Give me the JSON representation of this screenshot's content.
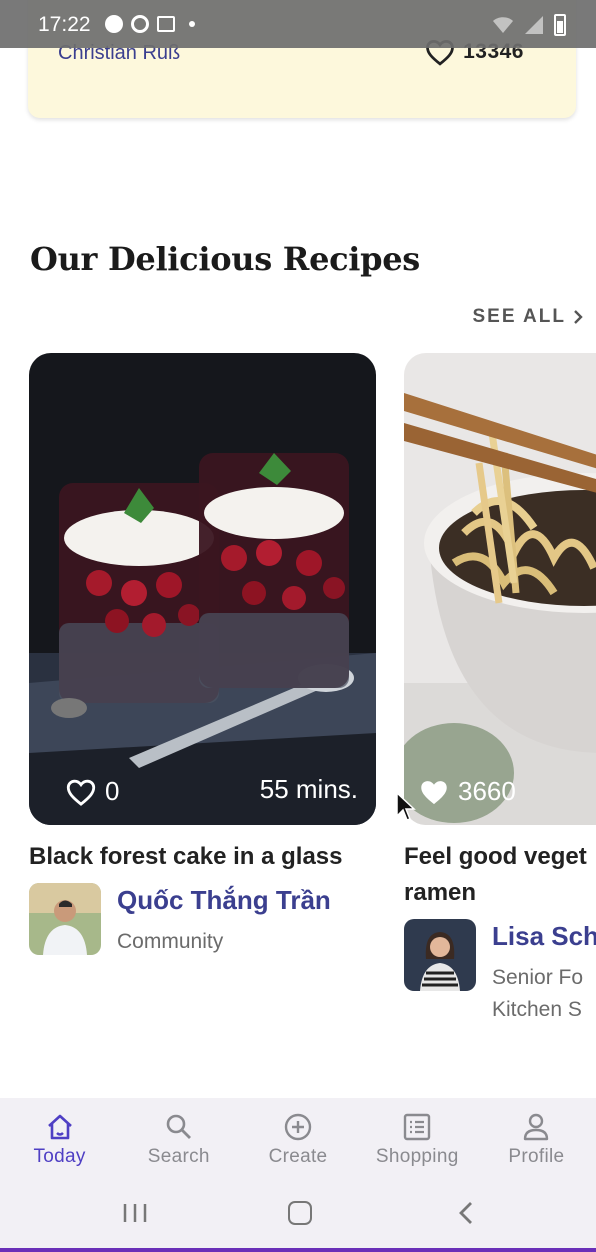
{
  "status_bar": {
    "time": "17:22"
  },
  "featured_card": {
    "author": "Christian Ruß",
    "likes": "13346"
  },
  "section": {
    "title": "Our Delicious Recipes",
    "see_all": "SEE ALL"
  },
  "recipes": [
    {
      "likes": "0",
      "time": "55 mins.",
      "title": "Black forest cake in a glass",
      "author_name": "Quốc Thắng Trần",
      "author_role": "Community"
    },
    {
      "likes": "3660",
      "time": "",
      "title": "Feel good veget\nramen",
      "author_name": "Lisa Sch",
      "author_role": "Senior Fo\nKitchen S"
    }
  ],
  "bottom_nav": [
    {
      "label": "Today",
      "icon": "home-icon",
      "active": true
    },
    {
      "label": "Search",
      "icon": "search-icon",
      "active": false
    },
    {
      "label": "Create",
      "icon": "plus-circle-icon",
      "active": false
    },
    {
      "label": "Shopping",
      "icon": "list-icon",
      "active": false
    },
    {
      "label": "Profile",
      "icon": "person-icon",
      "active": false
    }
  ],
  "colors": {
    "accent": "#4f3fc4",
    "author_link": "#3b3f8f",
    "card_bg": "#fdf8dc"
  }
}
